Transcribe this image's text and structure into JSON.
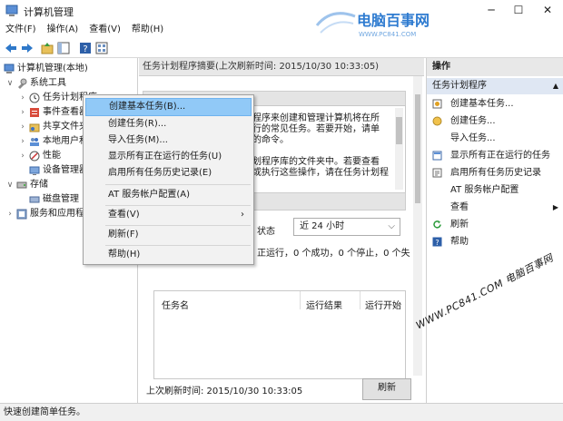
{
  "window": {
    "title": "计算机管理",
    "minimize": "─",
    "maximize": "☐",
    "close": "✕"
  },
  "watermark_top": {
    "main": "电脑百事网",
    "sub": "WWW.PC841.COM"
  },
  "watermark_bottom": "WWW.PC841.COM 电脑百事网",
  "menu": [
    "文件(F)",
    "操作(A)",
    "查看(V)",
    "帮助(H)"
  ],
  "toolbar_icons": [
    "back-arrow-icon",
    "forward-arrow-icon",
    "up-folder-icon",
    "show-hide-tree-icon",
    "help-icon",
    "properties-icon"
  ],
  "tree": [
    {
      "label": "计算机管理(本地)",
      "chev": "",
      "icon": "computer-icon"
    },
    {
      "label": "系统工具",
      "chev": "∨",
      "icon": "tools-icon"
    },
    {
      "label": "任务计划程序",
      "chev": "›",
      "icon": "clock-icon"
    },
    {
      "label": "事件查看器",
      "chev": "›",
      "icon": "event-viewer-icon"
    },
    {
      "label": "共享文件夹",
      "chev": "›",
      "icon": "shared-folder-icon"
    },
    {
      "label": "本地用户和组",
      "chev": "›",
      "icon": "users-icon"
    },
    {
      "label": "性能",
      "chev": "›",
      "icon": "performance-icon"
    },
    {
      "label": "设备管理器",
      "chev": "",
      "icon": "device-manager-icon"
    },
    {
      "label": "存储",
      "chev": "∨",
      "icon": "storage-icon"
    },
    {
      "label": "磁盘管理",
      "chev": "",
      "icon": "disk-icon"
    },
    {
      "label": "服务和应用程序",
      "chev": "›",
      "icon": "services-icon"
    }
  ],
  "center": {
    "header": "任务计划程序摘要(上次刷新时间: 2015/10/30 10:33:05)",
    "overview_lines": [
      "程序来创建和管理计算机将在所",
      "行的常见任务。若要开始，请单",
      "的命令。",
      "",
      "划程序库的文件夹中。若要查看",
      "或执行这些操作，请在任务计划程"
    ],
    "status_label": "状态",
    "status_select": "近 24 小时",
    "status_line": "正运行，0 个成功，0 个停止，0 个失",
    "columns": [
      "任务名",
      "运行结果",
      "运行开始"
    ],
    "last_refresh": "上次刷新时间: 2015/10/30 10:33:05",
    "refresh_button": "刷新"
  },
  "actions": {
    "header": "操作",
    "section": "任务计划程序",
    "section_arrow": "▲",
    "items": [
      {
        "label": "创建基本任务...",
        "icon": "create-basic-task-icon"
      },
      {
        "label": "创建任务...",
        "icon": "create-task-icon"
      },
      {
        "label": "导入任务...",
        "icon": ""
      },
      {
        "label": "显示所有正在运行的任务",
        "icon": "running-tasks-icon"
      },
      {
        "label": "启用所有任务历史记录",
        "icon": "history-icon"
      },
      {
        "label": "AT 服务帐户配置",
        "icon": ""
      },
      {
        "label": "查看",
        "icon": "",
        "arrow": "▶"
      },
      {
        "label": "刷新",
        "icon": "refresh-icon"
      },
      {
        "label": "帮助",
        "icon": "help-icon"
      }
    ]
  },
  "context_menu": [
    {
      "label": "创建基本任务(B)...",
      "highlight": true
    },
    {
      "label": "创建任务(R)..."
    },
    {
      "label": "导入任务(M)..."
    },
    {
      "label": "显示所有正在运行的任务(U)"
    },
    {
      "label": "启用所有任务历史记录(E)"
    },
    {
      "sep": true
    },
    {
      "label": "AT 服务帐户配置(A)"
    },
    {
      "sep": true
    },
    {
      "label": "查看(V)",
      "arrow": "›"
    },
    {
      "sep": true
    },
    {
      "label": "刷新(F)"
    },
    {
      "sep": true
    },
    {
      "label": "帮助(H)"
    }
  ],
  "status_bar": "快速创建简单任务。",
  "colors": {
    "accent": "#0078d7",
    "highlight": "#91c9f7",
    "section_bg": "#dfe7f3",
    "watermark": "#2e7bd0"
  }
}
